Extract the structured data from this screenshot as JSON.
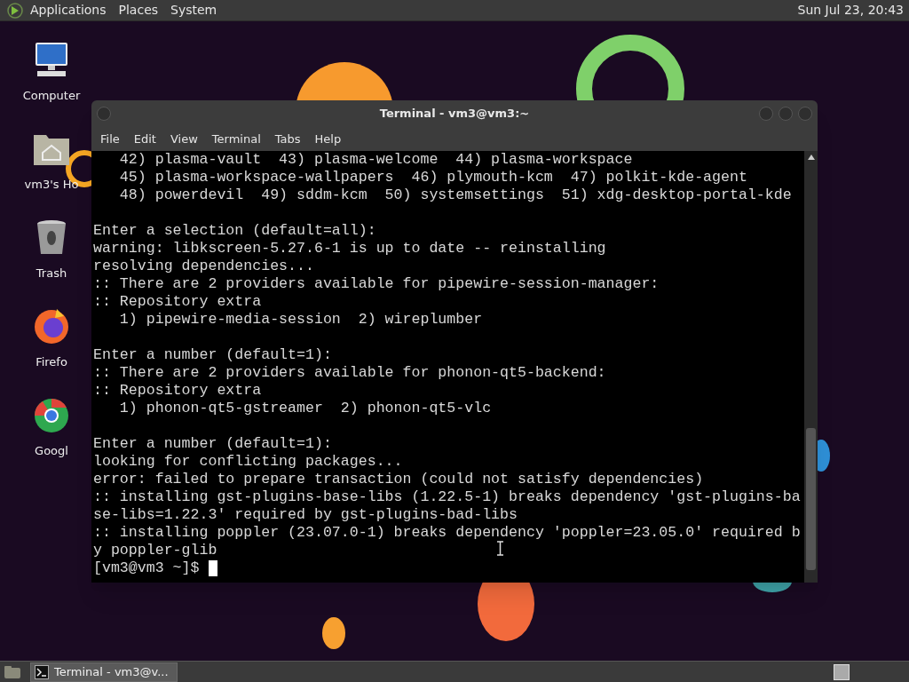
{
  "top_panel": {
    "menus": [
      "Applications",
      "Places",
      "System"
    ],
    "clock": "Sun Jul 23, 20:43"
  },
  "desktop_icons": [
    {
      "kind": "computer",
      "label": "Computer"
    },
    {
      "kind": "home",
      "label": "vm3's Ho"
    },
    {
      "kind": "trash",
      "label": "Trash"
    },
    {
      "kind": "firefox",
      "label": "Firefo"
    },
    {
      "kind": "chrome",
      "label": "Googl"
    }
  ],
  "terminal": {
    "title": "Terminal - vm3@vm3:~",
    "menu": [
      "File",
      "Edit",
      "View",
      "Terminal",
      "Tabs",
      "Help"
    ],
    "blocks": [
      [
        "   42) plasma-vault  43) plasma-welcome  44) plasma-workspace",
        "   45) plasma-workspace-wallpapers  46) plymouth-kcm  47) polkit-kde-agent",
        "   48) powerdevil  49) sddm-kcm  50) systemsettings  51) xdg-desktop-portal-kde"
      ],
      [
        "Enter a selection (default=all):",
        "warning: libkscreen-5.27.6-1 is up to date -- reinstalling",
        "resolving dependencies...",
        ":: There are 2 providers available for pipewire-session-manager:",
        ":: Repository extra",
        "   1) pipewire-media-session  2) wireplumber"
      ],
      [
        "Enter a number (default=1):",
        ":: There are 2 providers available for phonon-qt5-backend:",
        ":: Repository extra",
        "   1) phonon-qt5-gstreamer  2) phonon-qt5-vlc"
      ],
      [
        "Enter a number (default=1):",
        "looking for conflicting packages...",
        "error: failed to prepare transaction (could not satisfy dependencies)",
        ":: installing gst-plugins-base-libs (1.22.5-1) breaks dependency 'gst-plugins-ba",
        "se-libs=1.22.3' required by gst-plugins-bad-libs",
        ":: installing poppler (23.07.0-1) breaks dependency 'poppler=23.05.0' required b",
        "y poppler-glib"
      ]
    ],
    "prompt": "[vm3@vm3 ~]$"
  },
  "taskbar": {
    "tasks": [
      {
        "label": "Terminal - vm3@v...",
        "selected": true
      }
    ]
  }
}
